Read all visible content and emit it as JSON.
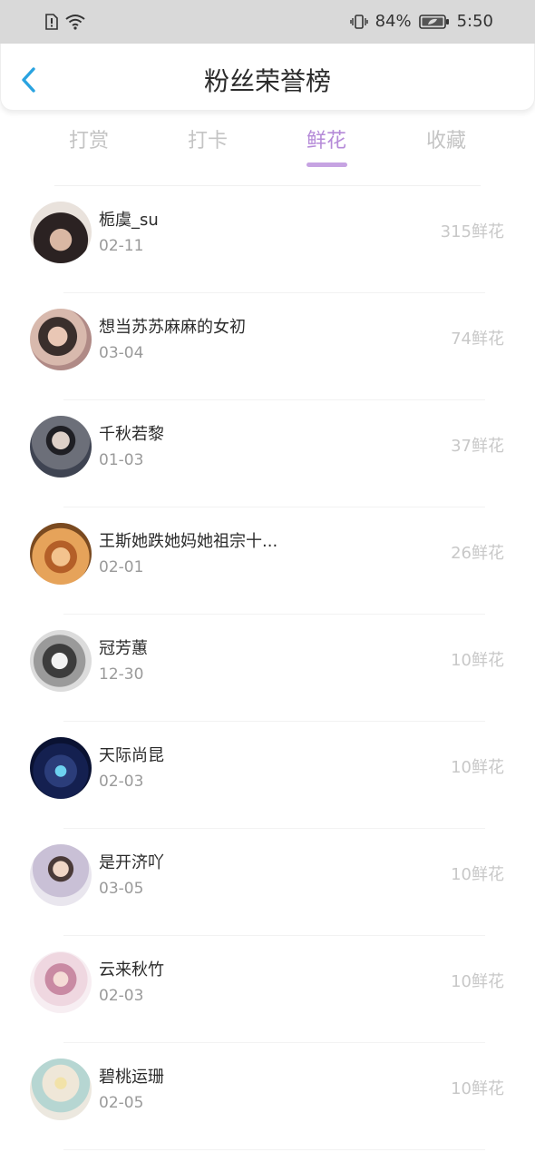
{
  "status_bar": {
    "battery_percent": "84%",
    "time": "5:50"
  },
  "header": {
    "title": "粉丝荣誉榜"
  },
  "tabs": [
    {
      "label": "打赏"
    },
    {
      "label": "打卡"
    },
    {
      "label": "鲜花"
    },
    {
      "label": "收藏"
    }
  ],
  "active_tab": "鲜花",
  "colors": {
    "accent_purple": "#b58ad8",
    "underline": "#c6a3e2",
    "back_blue": "#2aa3e0"
  },
  "fans": [
    {
      "name": "栀虞_su",
      "date": "02-11",
      "count": "315鲜花"
    },
    {
      "name": "想当苏苏麻麻的女初",
      "date": "03-04",
      "count": "74鲜花"
    },
    {
      "name": "千秋若黎",
      "date": "01-03",
      "count": "37鲜花"
    },
    {
      "name": "王斯她跌她妈她祖宗十...",
      "date": "02-01",
      "count": "26鲜花"
    },
    {
      "name": "冠芳蕙",
      "date": "12-30",
      "count": "10鲜花"
    },
    {
      "name": "天际尚昆",
      "date": "02-03",
      "count": "10鲜花"
    },
    {
      "name": "是开济吖",
      "date": "03-05",
      "count": "10鲜花"
    },
    {
      "name": "云来秋竹",
      "date": "02-03",
      "count": "10鲜花"
    },
    {
      "name": "碧桃运珊",
      "date": "02-05",
      "count": "10鲜花"
    }
  ]
}
